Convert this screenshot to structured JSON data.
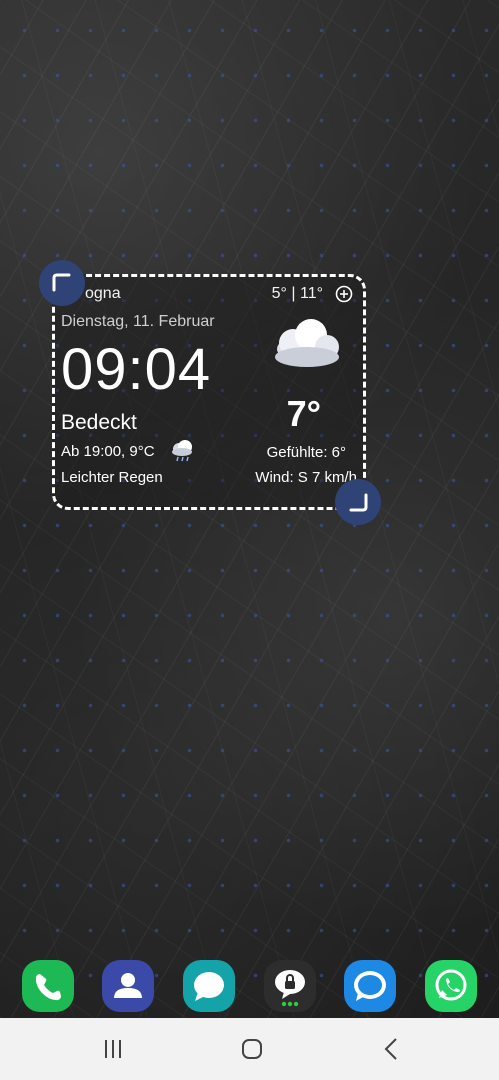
{
  "widget": {
    "location": "ogna",
    "temp_range": "5° | 11°",
    "date": "Dienstag, 11. Februar",
    "time": "09:04",
    "condition": "Bedeckt",
    "forecast_from": "Ab 19:00, 9°C",
    "forecast_condition": "Leichter Regen",
    "current_temp": "7°",
    "feels_like": "Gefühlte: 6°",
    "wind": "Wind: S 7 km/h",
    "icons": [
      "add-icon",
      "cloud-icon",
      "rain-cloud-icon"
    ]
  },
  "dock": {
    "apps": [
      {
        "name": "phone",
        "color": "#1db954"
      },
      {
        "name": "contacts",
        "color": "#3b4aa8"
      },
      {
        "name": "messages",
        "color": "#14a3a8"
      },
      {
        "name": "secure-folder",
        "color": "#2d2d2d"
      },
      {
        "name": "chat",
        "color": "#1e88e5"
      },
      {
        "name": "whatsapp",
        "color": "#25d366"
      }
    ]
  },
  "navbar": {
    "buttons": [
      "recent-apps",
      "home",
      "back"
    ]
  },
  "colors": {
    "handle": "#2f4376",
    "navbar_bg": "#f2f2f2"
  }
}
